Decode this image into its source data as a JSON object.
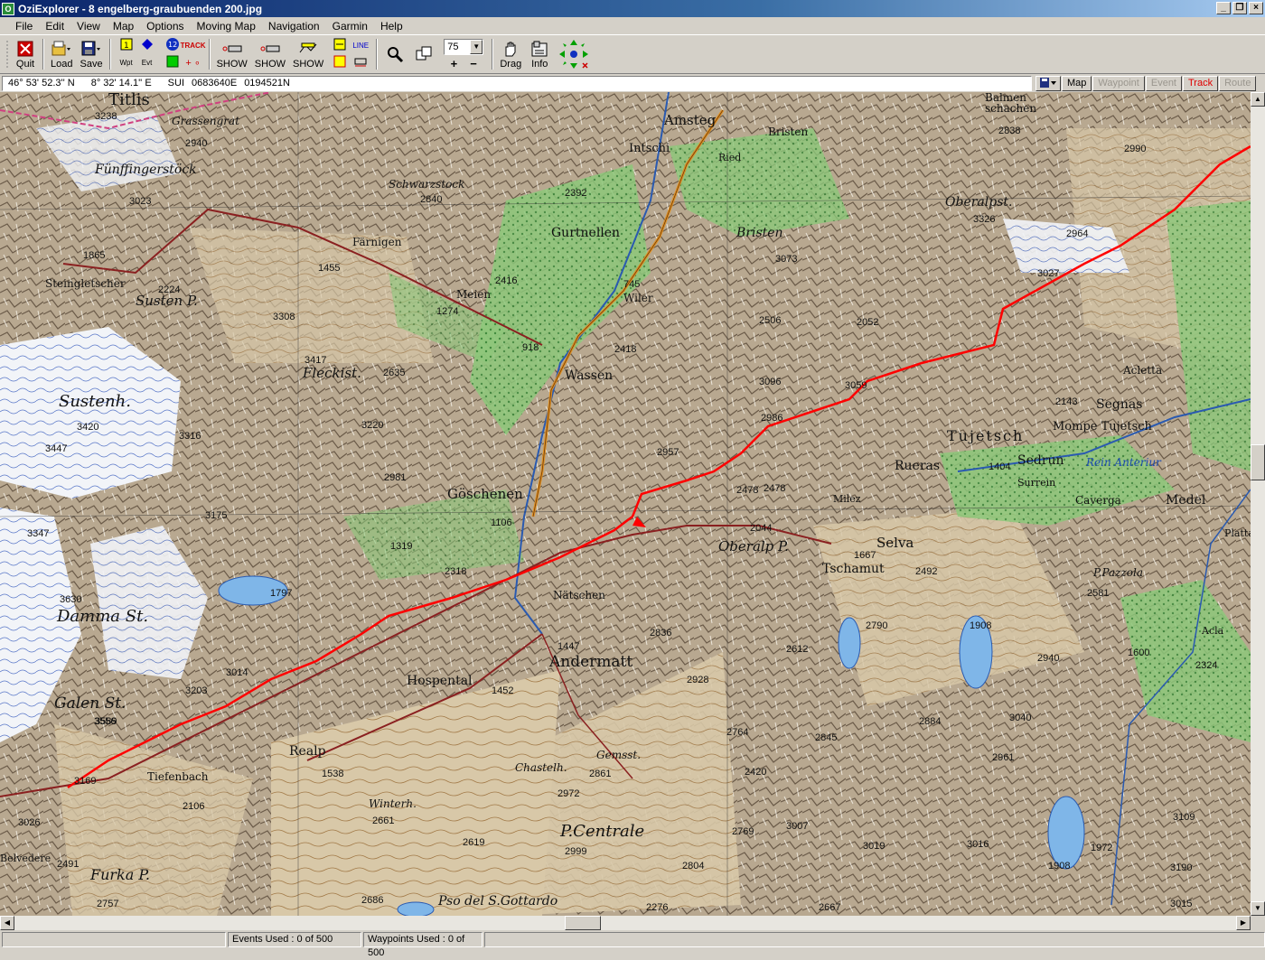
{
  "window": {
    "title": "OziExplorer - 8 engelberg-graubuenden 200.jpg"
  },
  "menu": [
    "File",
    "Edit",
    "View",
    "Map",
    "Options",
    "Moving Map",
    "Navigation",
    "Garmin",
    "Help"
  ],
  "toolbar": {
    "quit": "Quit",
    "load": "Load",
    "save": "Save",
    "wpt": "Wpt",
    "evt": "Evt",
    "track_label": "TRACK",
    "show_label": "SHOW",
    "zoom_value": "75",
    "zoom_in": "+",
    "zoom_out": "−",
    "drag": "Drag",
    "info": "Info"
  },
  "coords": {
    "lat": "46° 53' 52.3'' N",
    "lon": "8° 32' 14.1'' E",
    "grid": "SUI",
    "easting": "0683640E",
    "northing": "0194521N"
  },
  "mode_tabs": [
    {
      "label": "Map",
      "state": "normal"
    },
    {
      "label": "Waypoint",
      "state": "disabled"
    },
    {
      "label": "Event",
      "state": "disabled"
    },
    {
      "label": "Track",
      "state": "active"
    },
    {
      "label": "Route",
      "state": "disabled"
    }
  ],
  "status": {
    "events": "Events Used : 0 of 500",
    "waypoints": "Waypoints Used : 0 of 500"
  },
  "map_labels": {
    "titlis": "Titlis",
    "amsteg": "Amsteg",
    "balmen": "Balmen",
    "schachen": "schachen",
    "intschi": "Intschi",
    "ried": "Ried",
    "bristen_v": "Bristen",
    "grassengrat": "Grassengrat",
    "fuenffinger": "Fünffingerstöck",
    "schwarzstock": "Schwarzstock",
    "gurtnellen": "Gurtnellen",
    "wiler": "Wiler",
    "bristen_peak": "Bristen",
    "oberalpst": "Oberalpst.",
    "faernigen": "Färnigen",
    "steingletscher": "Steingletscher",
    "susten_p": "Susten P.",
    "meien": "Meien",
    "wassen": "Wassen",
    "fleckist": "Fleckist.",
    "sustenh": "Sustenh.",
    "aletta": "Acletta",
    "segnas": "Segnas",
    "tujetsch": "Tujetsch",
    "mompe": "Mompe Tujetsch",
    "ruera": "Rueras",
    "sedrun": "Sedrun",
    "surrhein": "Surrein",
    "medel": "Medel",
    "rein_anteriur": "Rein Anteriur",
    "caveiga": "Caverga",
    "goeschenen": "Göschenen",
    "oberalp_p": "Oberalp P.",
    "selva": "Selva",
    "tschamut": "Tschamut",
    "milez": "Milez",
    "naetschen": "Nätschen",
    "andermatt": "Andermatt",
    "damma": "Damma St.",
    "hospental": "Hospental",
    "galen": "Galen St.",
    "realp": "Realp",
    "tiefenbach": "Tiefenbach",
    "furka": "Furka P.",
    "pcentrale": "P.Centrale",
    "gotthard": "Pso del S.Gottardo",
    "belvedere": "Belvedere",
    "pazzola": "P.Pazzola",
    "platta": "Platta",
    "acla": "Acla",
    "winterh": "Winterh.",
    "chastelh": "Chastelh.",
    "gemsst": "Gemsst."
  },
  "map_numbers": [
    "3238",
    "2940",
    "3023",
    "2840",
    "2392",
    "2838",
    "2990",
    "2964",
    "3326",
    "3027",
    "3073",
    "1865",
    "2224",
    "1455",
    "1274",
    "2416",
    "745",
    "2506",
    "2052",
    "3308",
    "2478",
    "2418",
    "918",
    "3417",
    "2635",
    "3096",
    "3059",
    "2143",
    "3420",
    "3316",
    "3220",
    "2957",
    "2986",
    "2981",
    "3447",
    "1404",
    "2478",
    "3175",
    "1106",
    "2044",
    "1667",
    "3347",
    "1319",
    "1797",
    "2318",
    "2492",
    "2581",
    "3630",
    "1447",
    "2790",
    "1908",
    "2836",
    "2612",
    "2928",
    "1600",
    "3589",
    "3203",
    "3014",
    "1452",
    "2324",
    "3556",
    "2884",
    "3040",
    "2940",
    "2764",
    "2845",
    "2420",
    "3169",
    "1538",
    "2861",
    "2961",
    "2106",
    "2972",
    "3026",
    "2661",
    "2769",
    "3007",
    "3019",
    "3016",
    "3109",
    "2619",
    "2999",
    "2804",
    "1972",
    "1908",
    "3190",
    "2491",
    "2757",
    "2686",
    "2276",
    "2667",
    "3015"
  ]
}
